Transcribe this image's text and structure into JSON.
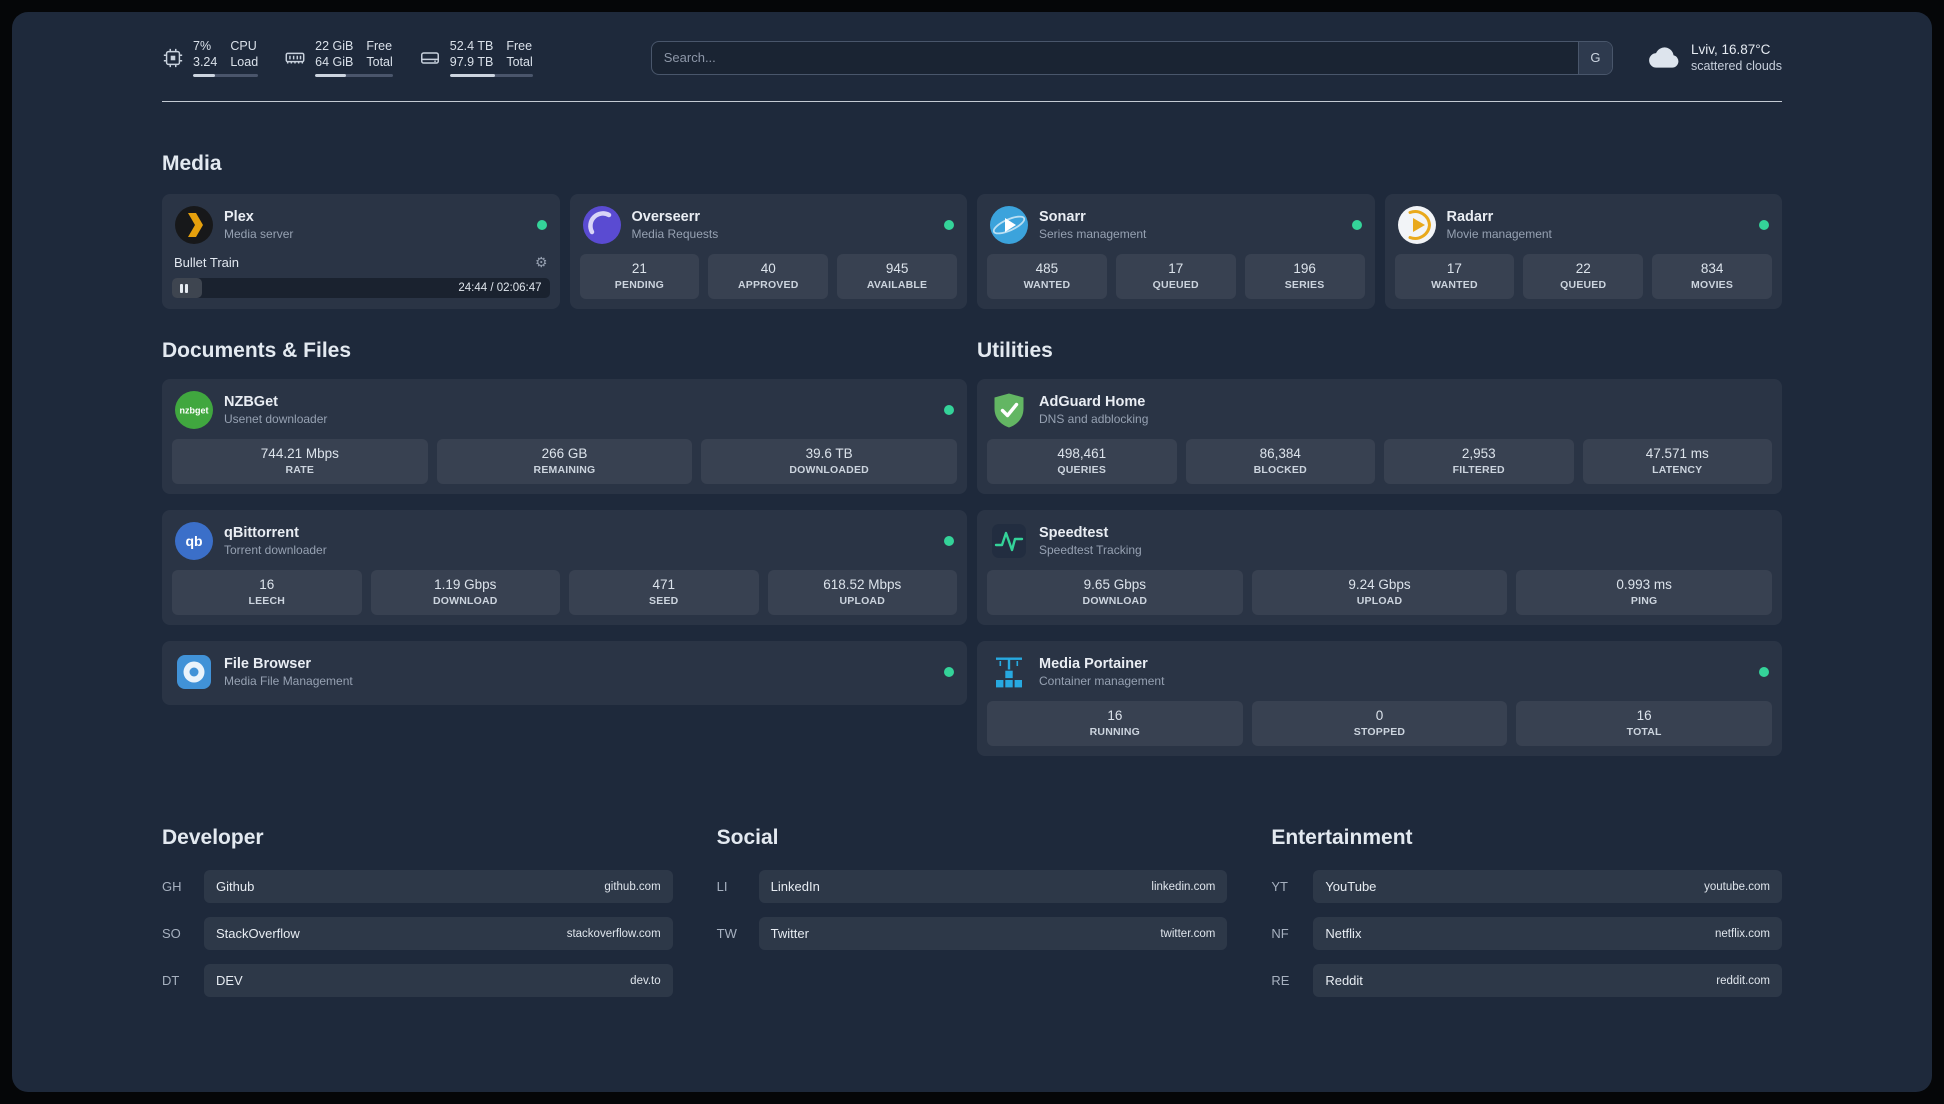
{
  "colors": {
    "status_online": "#34d399",
    "plex_amber": "#e5a00d"
  },
  "topbar": {
    "cpu": {
      "value_top": "7%",
      "value_bottom": "3.24",
      "label_top": "CPU",
      "label_bottom": "Load",
      "bar_percent": 33
    },
    "memory": {
      "value_top": "22 GiB",
      "value_bottom": "64 GiB",
      "label_top": "Free",
      "label_bottom": "Total",
      "bar_percent": 40
    },
    "disk": {
      "value_top": "52.4 TB",
      "value_bottom": "97.9 TB",
      "label_top": "Free",
      "label_bottom": "Total",
      "bar_percent": 54
    },
    "search": {
      "placeholder": "Search...",
      "provider_badge": "G"
    },
    "weather": {
      "location": "Lviv, 16.87°C",
      "condition": "scattered clouds"
    }
  },
  "media": {
    "title": "Media",
    "plex": {
      "name": "Plex",
      "subtitle": "Media server",
      "icon": "plex-icon",
      "status": "online",
      "now_playing": "Bullet Train",
      "progress_percent": 8,
      "time": "24:44 / 02:06:47"
    },
    "overseerr": {
      "name": "Overseerr",
      "subtitle": "Media Requests",
      "icon": "overseerr-icon",
      "status": "online",
      "stats": [
        {
          "value": "21",
          "label": "PENDING"
        },
        {
          "value": "40",
          "label": "APPROVED"
        },
        {
          "value": "945",
          "label": "AVAILABLE"
        }
      ]
    },
    "sonarr": {
      "name": "Sonarr",
      "subtitle": "Series management",
      "icon": "sonarr-icon",
      "status": "online",
      "stats": [
        {
          "value": "485",
          "label": "WANTED"
        },
        {
          "value": "17",
          "label": "QUEUED"
        },
        {
          "value": "196",
          "label": "SERIES"
        }
      ]
    },
    "radarr": {
      "name": "Radarr",
      "subtitle": "Movie management",
      "icon": "radarr-icon",
      "status": "online",
      "stats": [
        {
          "value": "17",
          "label": "WANTED"
        },
        {
          "value": "22",
          "label": "QUEUED"
        },
        {
          "value": "834",
          "label": "MOVIES"
        }
      ]
    }
  },
  "documents": {
    "title": "Documents & Files",
    "nzbget": {
      "name": "NZBGet",
      "subtitle": "Usenet downloader",
      "icon": "nzbget-icon",
      "status": "online",
      "stats": [
        {
          "value": "744.21 Mbps",
          "label": "RATE"
        },
        {
          "value": "266 GB",
          "label": "REMAINING"
        },
        {
          "value": "39.6 TB",
          "label": "DOWNLOADED"
        }
      ]
    },
    "qbittorrent": {
      "name": "qBittorrent",
      "subtitle": "Torrent downloader",
      "icon": "qbittorrent-icon",
      "status": "online",
      "stats": [
        {
          "value": "16",
          "label": "LEECH"
        },
        {
          "value": "1.19 Gbps",
          "label": "DOWNLOAD"
        },
        {
          "value": "471",
          "label": "SEED"
        },
        {
          "value": "618.52 Mbps",
          "label": "UPLOAD"
        }
      ]
    },
    "filebrowser": {
      "name": "File Browser",
      "subtitle": "Media File Management",
      "icon": "filebrowser-icon",
      "status": "online"
    }
  },
  "utilities": {
    "title": "Utilities",
    "adguard": {
      "name": "AdGuard Home",
      "subtitle": "DNS and adblocking",
      "icon": "adguard-icon",
      "stats": [
        {
          "value": "498,461",
          "label": "QUERIES"
        },
        {
          "value": "86,384",
          "label": "BLOCKED"
        },
        {
          "value": "2,953",
          "label": "FILTERED"
        },
        {
          "value": "47.571 ms",
          "label": "LATENCY"
        }
      ]
    },
    "speedtest": {
      "name": "Speedtest",
      "subtitle": "Speedtest Tracking",
      "icon": "speedtest-icon",
      "stats": [
        {
          "value": "9.65 Gbps",
          "label": "DOWNLOAD"
        },
        {
          "value": "9.24 Gbps",
          "label": "UPLOAD"
        },
        {
          "value": "0.993 ms",
          "label": "PING"
        }
      ]
    },
    "portainer": {
      "name": "Media Portainer",
      "subtitle": "Container management",
      "icon": "portainer-icon",
      "status": "online",
      "stats": [
        {
          "value": "16",
          "label": "RUNNING"
        },
        {
          "value": "0",
          "label": "STOPPED"
        },
        {
          "value": "16",
          "label": "TOTAL"
        }
      ]
    }
  },
  "bookmarks": {
    "developer": {
      "title": "Developer",
      "items": [
        {
          "abbr": "GH",
          "name": "Github",
          "url": "github.com"
        },
        {
          "abbr": "SO",
          "name": "StackOverflow",
          "url": "stackoverflow.com"
        },
        {
          "abbr": "DT",
          "name": "DEV",
          "url": "dev.to"
        }
      ]
    },
    "social": {
      "title": "Social",
      "items": [
        {
          "abbr": "LI",
          "name": "LinkedIn",
          "url": "linkedin.com"
        },
        {
          "abbr": "TW",
          "name": "Twitter",
          "url": "twitter.com"
        }
      ]
    },
    "entertainment": {
      "title": "Entertainment",
      "items": [
        {
          "abbr": "YT",
          "name": "YouTube",
          "url": "youtube.com"
        },
        {
          "abbr": "NF",
          "name": "Netflix",
          "url": "netflix.com"
        },
        {
          "abbr": "RE",
          "name": "Reddit",
          "url": "reddit.com"
        }
      ]
    }
  }
}
